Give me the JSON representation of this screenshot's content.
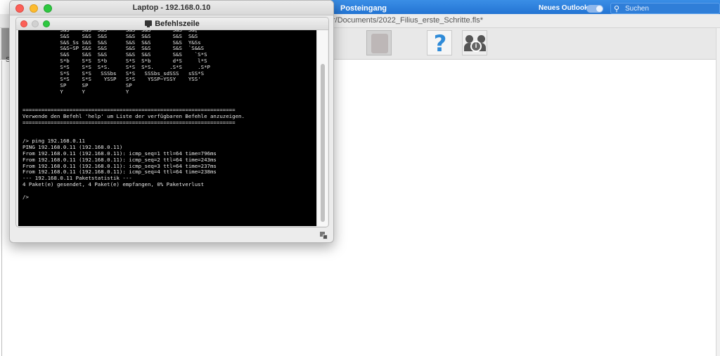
{
  "outlook": {
    "title": "Posteingang",
    "toggle_label": "Neues Outlook",
    "search_placeholder": "Suchen"
  },
  "filius": {
    "path": "r/Documents/2022_Filius_erste_Schritte.fls*",
    "left_fragment": "S"
  },
  "laptop": {
    "title": "Laptop - 192.168.0.10"
  },
  "terminal": {
    "title": "Befehlszeile",
    "lines": [
      "            S&S    S&S  S&S      S&S  S&S       S&S  S&[",
      "            S&S    S&S  S&S      S&S  S&S       S&S  S&S",
      "            S&S_Ss S&S  S&S      S&S  S&S       S&S  Y&Ss",
      "            S&S~SP S&S  S&S      S&S  S&S       S&S  `S&&S",
      "            S&S    S&S  S&S      S&S  S&S       S&S    `S*S",
      "            S*b    S*S  S*b      S*S  S*b       d*S     l*S",
      "            S*S    S*S  S*S.     S*S  S*S.     .S*S     .S*P",
      "            S*S    S*S   SSSbs   S*S   SSSbs_sdSSS   sSS*S",
      "            S*S    S*S    YSSP   S*S    YSSP~YSSY    YSS'",
      "            SP     SP            SP",
      "            Y      Y             Y",
      "",
      "",
      "====================================================================",
      "Verwende den Befehl 'help' um Liste der verfügbaren Befehle anzuzeigen.",
      "====================================================================",
      "",
      "",
      "/> ping 192.168.0.11",
      "PING 192.168.0.11 (192.168.0.11)",
      "From 192.168.0.11 (192.168.0.11): icmp_seq=1 ttl=64 time=796ms",
      "From 192.168.0.11 (192.168.0.11): icmp_seq=2 ttl=64 time=243ms",
      "From 192.168.0.11 (192.168.0.11): icmp_seq=3 ttl=64 time=237ms",
      "From 192.168.0.11 (192.168.0.11): icmp_seq=4 ttl=64 time=238ms",
      "--- 192.168.0.11 Paketstatistik ---",
      "4 Paket(e) gesendet, 4 Paket(e) empfangen, 0% Paketverlust",
      "",
      "/>"
    ]
  },
  "colors": {
    "outlook_blue": "#1f6fcf",
    "terminal_bg": "#000000",
    "terminal_fg": "#e8e8e8",
    "help_icon": "#2f8bd8"
  }
}
